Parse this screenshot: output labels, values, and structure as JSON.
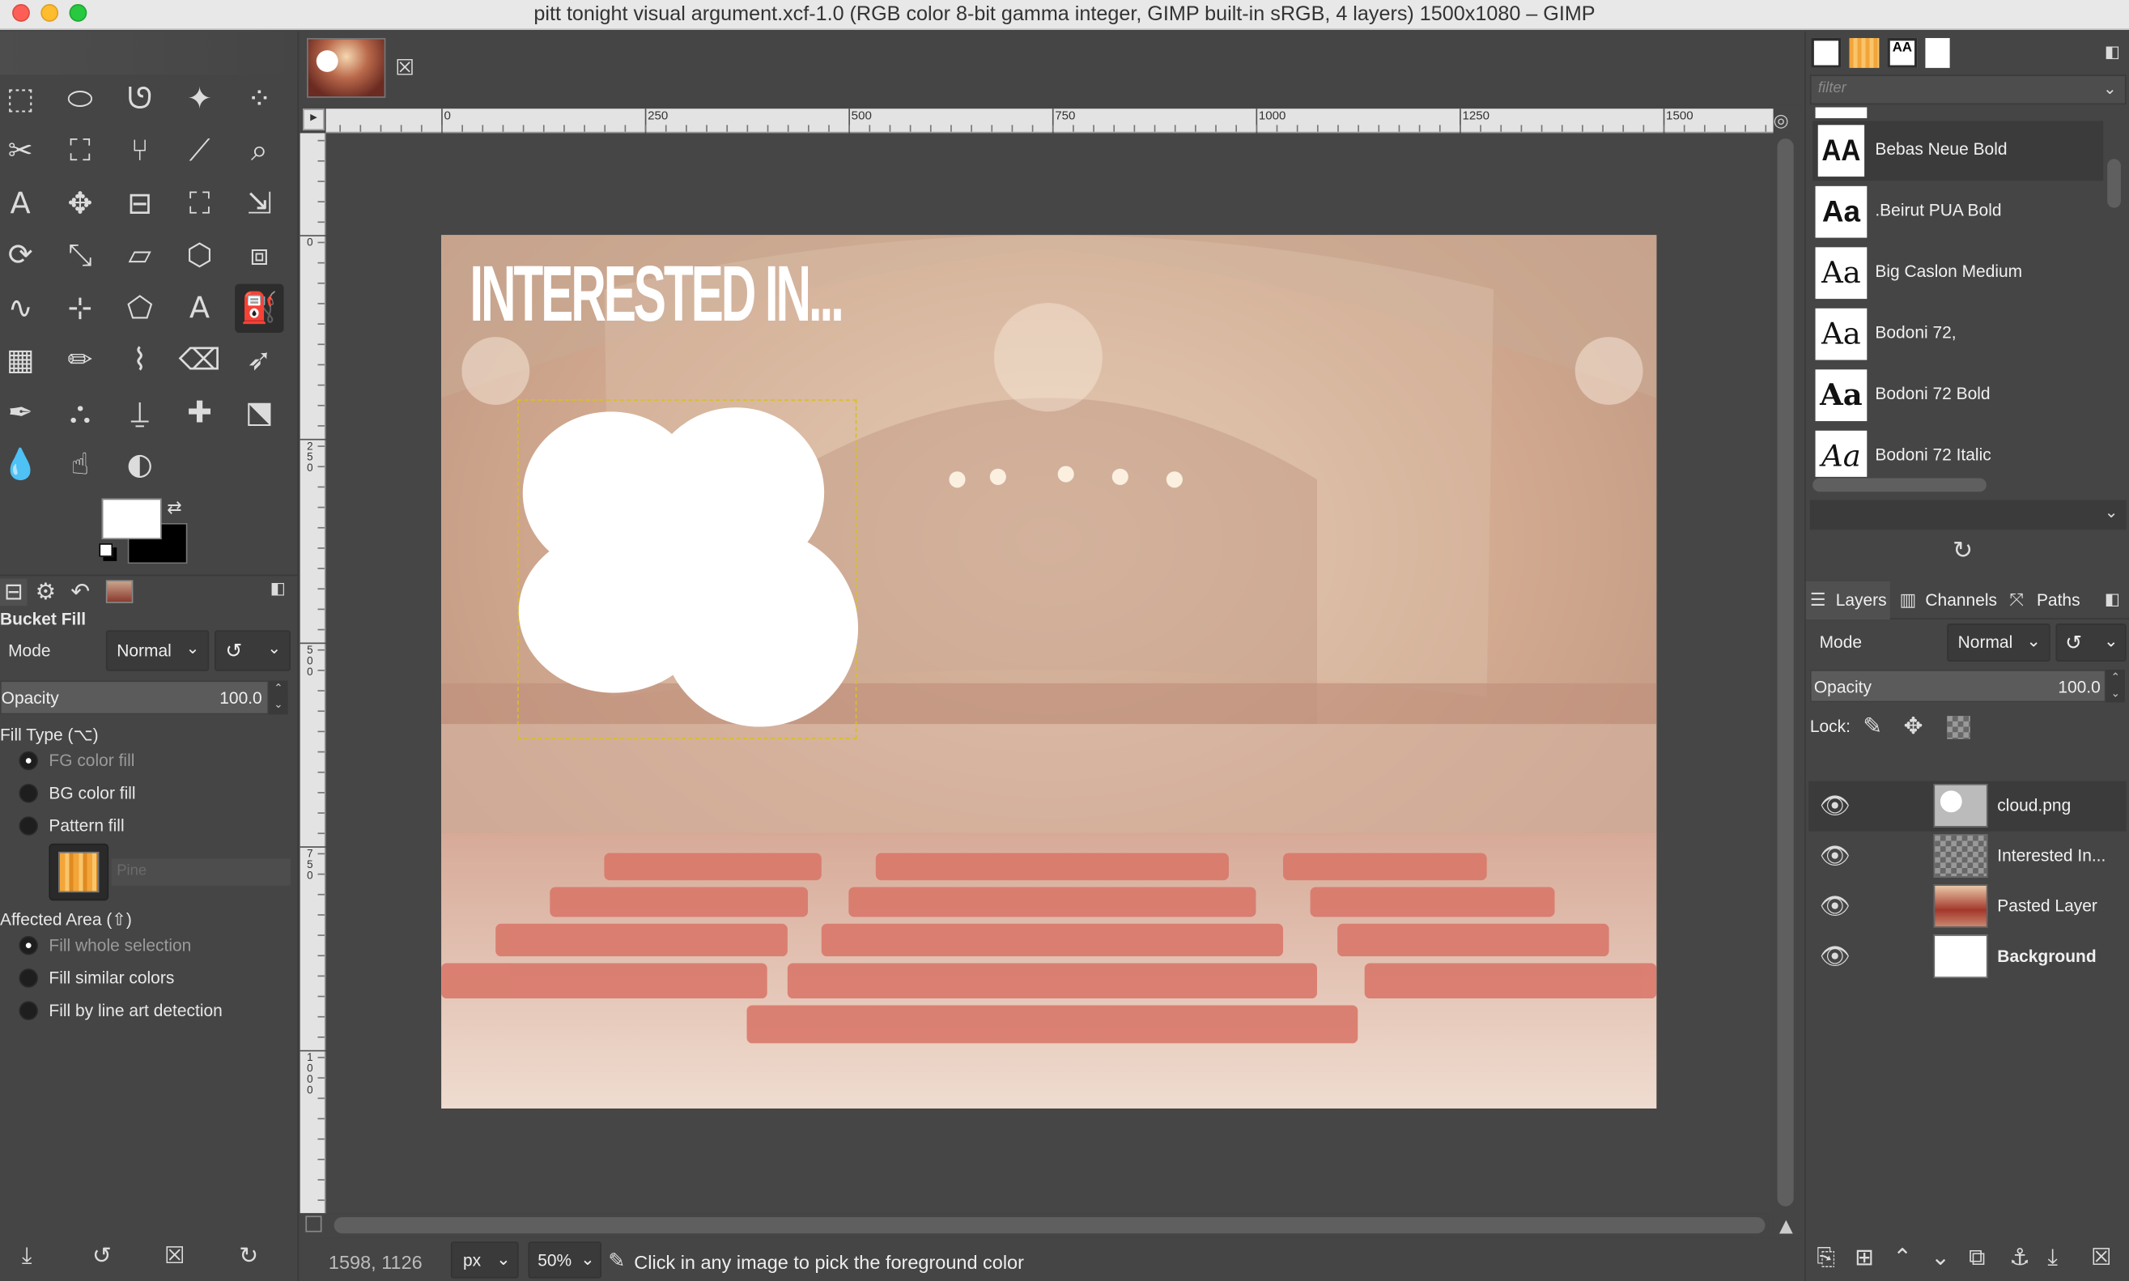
{
  "window": {
    "title": "pitt tonight visual argument.xcf-1.0 (RGB color 8-bit gamma integer, GIMP built-in sRGB, 4 layers) 1500x1080 – GIMP"
  },
  "toolbox": {
    "tools": [
      "rect-select",
      "ellipse-select",
      "free-select",
      "fuzzy-select",
      "select-by-color",
      "scissors-select",
      "foreground-select",
      "paths",
      "color-picker",
      "zoom",
      "measure",
      "move",
      "align",
      "crop",
      "unified-transform",
      "rotate",
      "scale",
      "shear",
      "perspective",
      "3d-transform",
      "warp-transform",
      "handle-transform",
      "cage-transform",
      "text",
      "bucket-fill",
      "gradient",
      "pencil",
      "paintbrush",
      "eraser",
      "airbrush",
      "ink",
      "mypaint-brush",
      "clone",
      "heal",
      "perspective-clone",
      "blur",
      "smudge",
      "dodge-burn"
    ],
    "active_tool": "bucket-fill",
    "fg_color": "#ffffff",
    "bg_color": "#000000"
  },
  "tool_options": {
    "title": "Bucket Fill",
    "mode_label": "Mode",
    "mode_value": "Normal",
    "opacity_label": "Opacity",
    "opacity_value": "100.0",
    "fill_type_label": "Fill Type  (⌥)",
    "fill_types": [
      "FG color fill",
      "BG color fill",
      "Pattern fill"
    ],
    "pattern_name": "Pine",
    "affected_area_label": "Affected Area  (⇧)",
    "affected_areas": [
      "Fill whole selection",
      "Fill similar colors",
      "Fill by line art detection"
    ]
  },
  "canvas": {
    "overlay_text": "INTERESTED IN...",
    "ruler_top": [
      "0",
      "250",
      "500",
      "750",
      "1000",
      "1250",
      "1500"
    ],
    "ruler_left": [
      "0",
      "250",
      "500",
      "750",
      "1000"
    ]
  },
  "status": {
    "coords": "1598, 1126",
    "unit": "px",
    "zoom": "50%",
    "message": "Click in any image to pick the foreground color"
  },
  "fonts": {
    "filter_placeholder": "filter",
    "items": [
      {
        "thumb": "AA",
        "name": "Bebas Neue Bold"
      },
      {
        "thumb": "Aa",
        "name": ".Beirut PUA Bold"
      },
      {
        "thumb": "Aa",
        "name": "Big Caslon Medium"
      },
      {
        "thumb": "Aa",
        "name": "Bodoni 72,"
      },
      {
        "thumb": "Aa",
        "name": "Bodoni 72 Bold"
      },
      {
        "thumb": "Aa",
        "name": "Bodoni 72 Italic"
      }
    ]
  },
  "layers_panel": {
    "tabs": [
      "Layers",
      "Channels",
      "Paths"
    ],
    "mode_label": "Mode",
    "mode_value": "Normal",
    "opacity_label": "Opacity",
    "opacity_value": "100.0",
    "lock_label": "Lock:",
    "layers": [
      {
        "name": "cloud.png",
        "bold": false
      },
      {
        "name": "Interested In...",
        "bold": false
      },
      {
        "name": "Pasted Layer",
        "bold": false
      },
      {
        "name": "Background",
        "bold": true
      }
    ]
  }
}
